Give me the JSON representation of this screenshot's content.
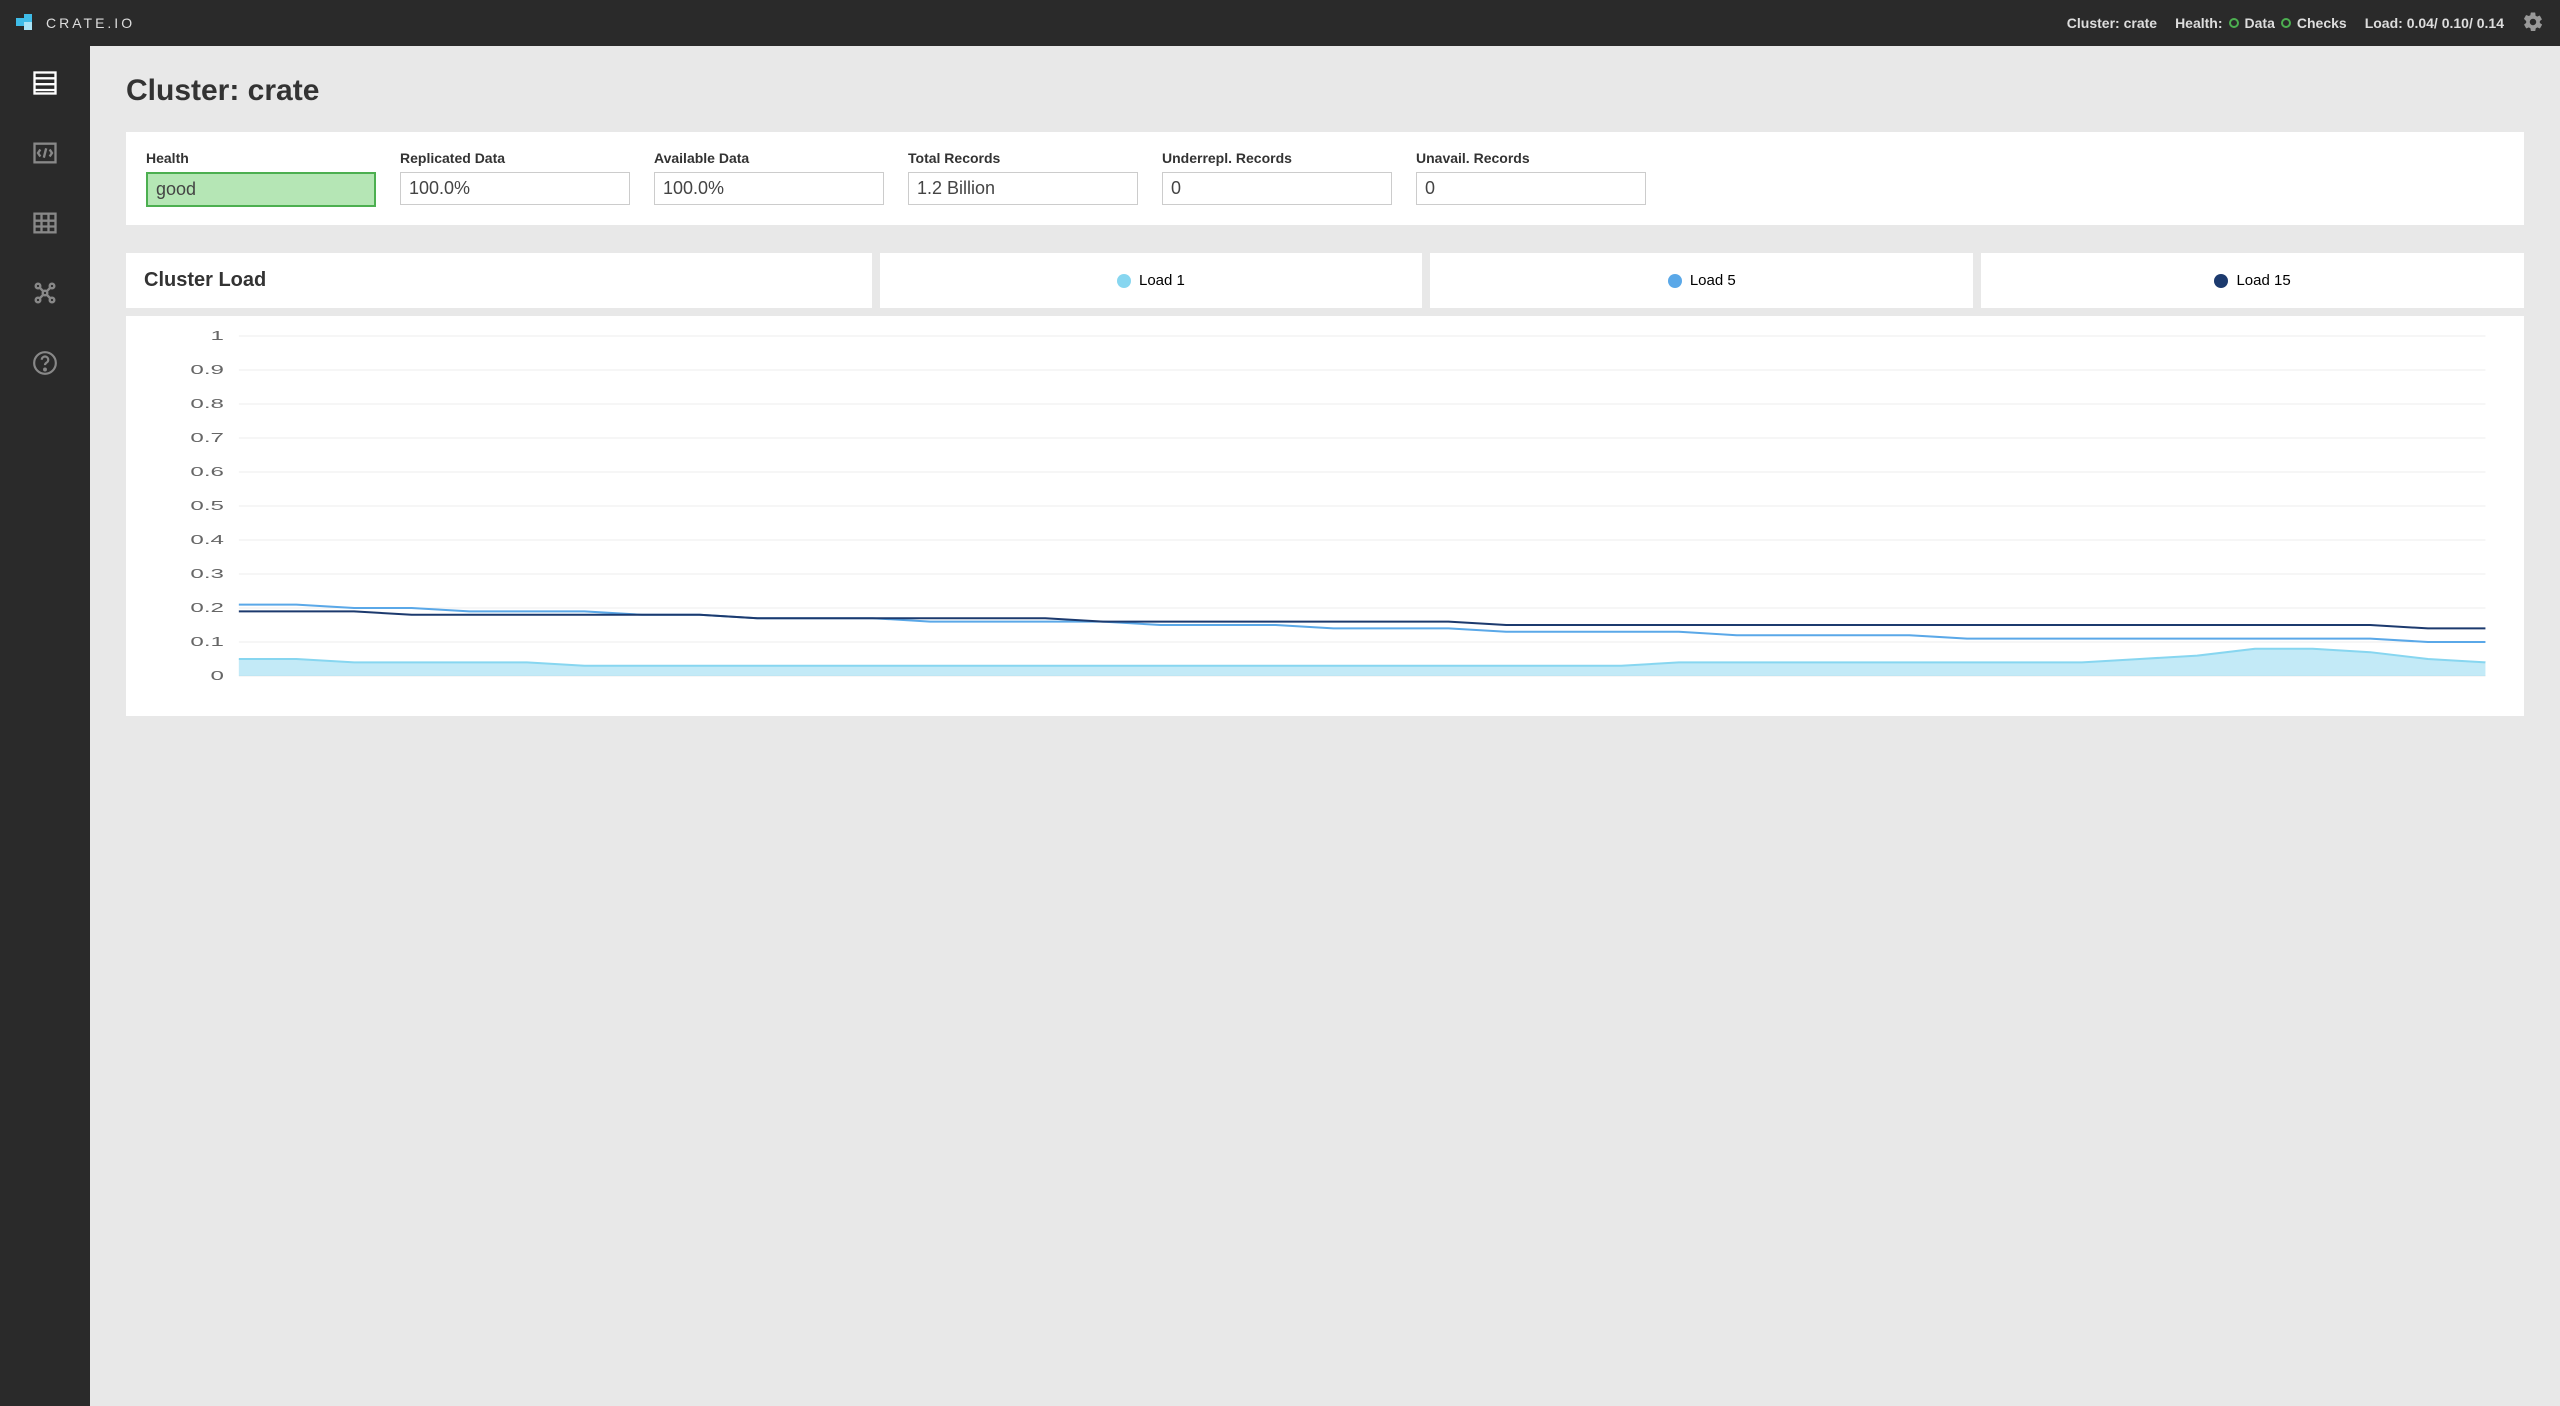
{
  "header": {
    "logo_text": "CRATE.IO",
    "cluster_label": "Cluster:",
    "cluster_name": "crate",
    "health_label": "Health:",
    "data_label": "Data",
    "checks_label": "Checks",
    "load_label": "Load:",
    "load_values": "0.04/ 0.10/ 0.14"
  },
  "page": {
    "title": "Cluster: crate"
  },
  "stats": {
    "health": {
      "label": "Health",
      "value": "good"
    },
    "replicated": {
      "label": "Replicated Data",
      "value": "100.0%"
    },
    "available": {
      "label": "Available Data",
      "value": "100.0%"
    },
    "total_records": {
      "label": "Total Records",
      "value": "1.2 Billion"
    },
    "underrepl": {
      "label": "Underrepl. Records",
      "value": "0"
    },
    "unavail": {
      "label": "Unavail. Records",
      "value": "0"
    }
  },
  "chart_header": {
    "title": "Cluster Load",
    "legend": [
      {
        "name": "Load 1",
        "color": "#87d6f0"
      },
      {
        "name": "Load 5",
        "color": "#5aa8e8"
      },
      {
        "name": "Load 15",
        "color": "#1c3a6e"
      }
    ]
  },
  "chart_data": {
    "type": "line",
    "title": "Cluster Load",
    "ylabel": "",
    "xlabel": "",
    "ylim": [
      0,
      1
    ],
    "y_ticks": [
      0,
      0.1,
      0.2,
      0.3,
      0.4,
      0.5,
      0.6,
      0.7,
      0.8,
      0.9,
      1
    ],
    "x": [
      0,
      1,
      2,
      3,
      4,
      5,
      6,
      7,
      8,
      9,
      10,
      11,
      12,
      13,
      14,
      15,
      16,
      17,
      18,
      19,
      20,
      21,
      22,
      23,
      24,
      25,
      26,
      27,
      28,
      29,
      30,
      31,
      32,
      33,
      34,
      35,
      36,
      37,
      38,
      39
    ],
    "series": [
      {
        "name": "Load 1",
        "color": "#87d6f0",
        "fill": true,
        "values": [
          0.05,
          0.05,
          0.04,
          0.04,
          0.04,
          0.04,
          0.03,
          0.03,
          0.03,
          0.03,
          0.03,
          0.03,
          0.03,
          0.03,
          0.03,
          0.03,
          0.03,
          0.03,
          0.03,
          0.03,
          0.03,
          0.03,
          0.03,
          0.03,
          0.03,
          0.04,
          0.04,
          0.04,
          0.04,
          0.04,
          0.04,
          0.04,
          0.04,
          0.05,
          0.06,
          0.08,
          0.08,
          0.07,
          0.05,
          0.04
        ]
      },
      {
        "name": "Load 5",
        "color": "#5aa8e8",
        "fill": false,
        "values": [
          0.21,
          0.21,
          0.2,
          0.2,
          0.19,
          0.19,
          0.19,
          0.18,
          0.18,
          0.17,
          0.17,
          0.17,
          0.16,
          0.16,
          0.16,
          0.16,
          0.15,
          0.15,
          0.15,
          0.14,
          0.14,
          0.14,
          0.13,
          0.13,
          0.13,
          0.13,
          0.12,
          0.12,
          0.12,
          0.12,
          0.11,
          0.11,
          0.11,
          0.11,
          0.11,
          0.11,
          0.11,
          0.11,
          0.1,
          0.1
        ]
      },
      {
        "name": "Load 15",
        "color": "#1c3a6e",
        "fill": false,
        "values": [
          0.19,
          0.19,
          0.19,
          0.18,
          0.18,
          0.18,
          0.18,
          0.18,
          0.18,
          0.17,
          0.17,
          0.17,
          0.17,
          0.17,
          0.17,
          0.16,
          0.16,
          0.16,
          0.16,
          0.16,
          0.16,
          0.16,
          0.15,
          0.15,
          0.15,
          0.15,
          0.15,
          0.15,
          0.15,
          0.15,
          0.15,
          0.15,
          0.15,
          0.15,
          0.15,
          0.15,
          0.15,
          0.15,
          0.14,
          0.14
        ]
      }
    ]
  }
}
